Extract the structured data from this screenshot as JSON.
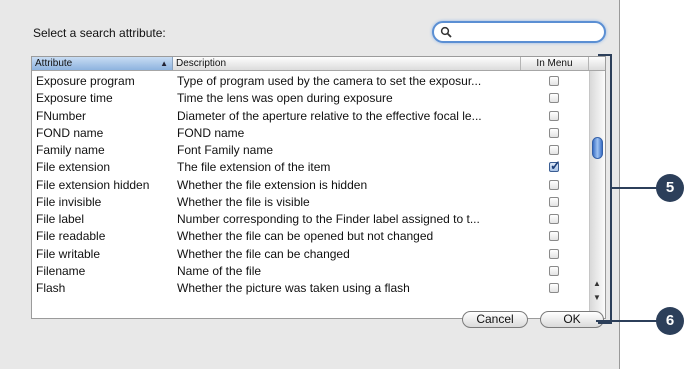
{
  "dialog": {
    "prompt": "Select a search attribute:",
    "search": {
      "value": "",
      "placeholder": ""
    },
    "columns": {
      "attribute": "Attribute",
      "description": "Description",
      "in_menu": "In Menu"
    },
    "rows": [
      {
        "attribute": "Exposure program",
        "description": "Type of program used by the camera to set the exposur...",
        "in_menu": false
      },
      {
        "attribute": "Exposure time",
        "description": "Time the lens was open during exposure",
        "in_menu": false
      },
      {
        "attribute": "FNumber",
        "description": "Diameter of the aperture relative to the effective focal le...",
        "in_menu": false
      },
      {
        "attribute": "FOND name",
        "description": "FOND name",
        "in_menu": false
      },
      {
        "attribute": "Family name",
        "description": "Font Family name",
        "in_menu": false
      },
      {
        "attribute": "File extension",
        "description": "The file extension of the item",
        "in_menu": true
      },
      {
        "attribute": "File extension hidden",
        "description": "Whether the file extension is hidden",
        "in_menu": false
      },
      {
        "attribute": "File invisible",
        "description": "Whether the file is visible",
        "in_menu": false
      },
      {
        "attribute": "File label",
        "description": "Number corresponding to the Finder label assigned to t...",
        "in_menu": false
      },
      {
        "attribute": "File readable",
        "description": "Whether the file can be opened but not changed",
        "in_menu": false
      },
      {
        "attribute": "File writable",
        "description": "Whether the file can be changed",
        "in_menu": false
      },
      {
        "attribute": "Filename",
        "description": "Name of the file",
        "in_menu": false
      },
      {
        "attribute": "Flash",
        "description": "Whether the picture was taken using a flash",
        "in_menu": false
      }
    ],
    "buttons": {
      "cancel": "Cancel",
      "ok": "OK"
    }
  },
  "callouts": {
    "five": "5",
    "six": "6"
  },
  "colors": {
    "accent": "#5b8fd3",
    "callout": "#2c3f5a"
  },
  "icons": {
    "search": "magnifier-icon",
    "sort": "sort-ascending-icon",
    "check": "checkmark-icon"
  }
}
